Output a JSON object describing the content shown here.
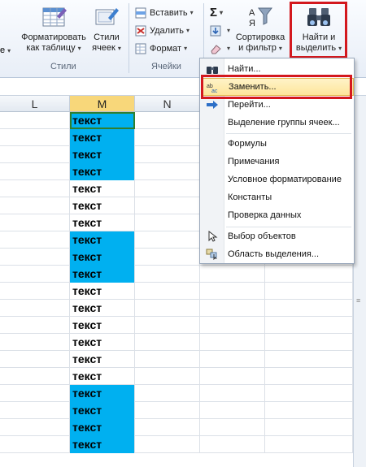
{
  "ribbon": {
    "format_table": [
      "Форматировать",
      "как таблицу"
    ],
    "cell_styles": [
      "Стили",
      "ячеек"
    ],
    "styles_group": "Стили",
    "insert": "Вставить",
    "delete": "Удалить",
    "format": "Формат",
    "cells_group": "Ячейки",
    "sort_filter": [
      "Сортировка",
      "и фильтр"
    ],
    "find_select": [
      "Найти и",
      "выделить"
    ],
    "sigma": "Σ",
    "left_arrow": "е"
  },
  "columns": [
    "L",
    "M",
    "N"
  ],
  "column_m_cells": [
    {
      "text": "текст",
      "highlight": true
    },
    {
      "text": "текст",
      "highlight": true
    },
    {
      "text": "текст",
      "highlight": true
    },
    {
      "text": "текст",
      "highlight": true
    },
    {
      "text": "текст",
      "highlight": false
    },
    {
      "text": "текст",
      "highlight": false
    },
    {
      "text": "текст",
      "highlight": false
    },
    {
      "text": "текст",
      "highlight": true
    },
    {
      "text": "текст",
      "highlight": true
    },
    {
      "text": "текст",
      "highlight": true
    },
    {
      "text": "текст",
      "highlight": false
    },
    {
      "text": "текст",
      "highlight": false
    },
    {
      "text": "текст",
      "highlight": false
    },
    {
      "text": "текст",
      "highlight": false
    },
    {
      "text": "текст",
      "highlight": false
    },
    {
      "text": "текст",
      "highlight": false
    },
    {
      "text": "текст",
      "highlight": true
    },
    {
      "text": "текст",
      "highlight": true
    },
    {
      "text": "текст",
      "highlight": true
    },
    {
      "text": "текст",
      "highlight": true
    }
  ],
  "menu": {
    "find": "Найти...",
    "replace": "Заменить...",
    "goto": "Перейти...",
    "goto_special": "Выделение группы ячеек...",
    "formulas": "Формулы",
    "comments": "Примечания",
    "conditional_formatting": "Условное форматирование",
    "constants": "Константы",
    "data_validation": "Проверка данных",
    "select_objects": "Выбор объектов",
    "selection_pane": "Область выделения..."
  },
  "colors": {
    "highlight_fill": "#00b0f0",
    "annotation_red": "#d3181e",
    "menu_hover": "#fde59a"
  }
}
